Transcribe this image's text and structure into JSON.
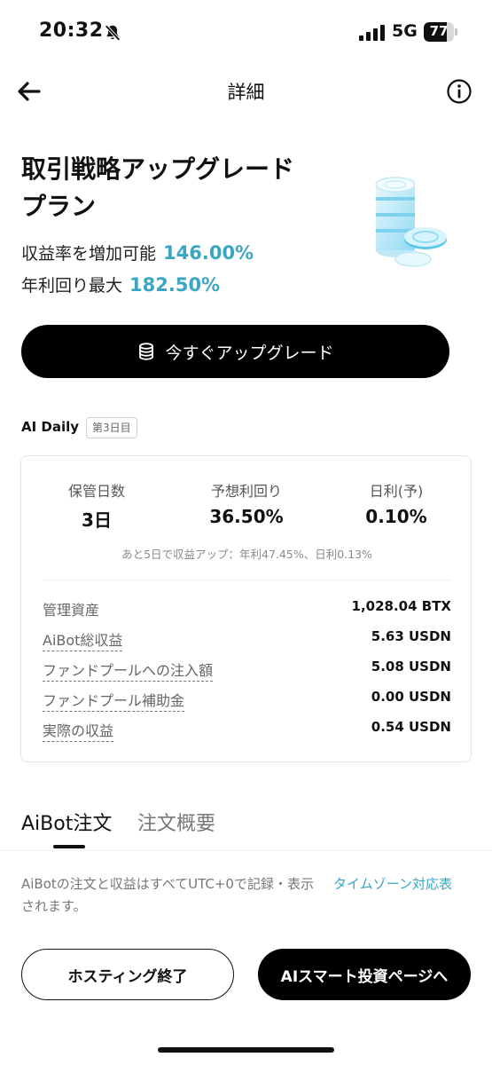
{
  "status_bar": {
    "time": "20:32",
    "network": "5G",
    "battery_percent": "77",
    "battery_level": 0.77
  },
  "nav": {
    "title": "詳細"
  },
  "hero": {
    "title": "取引戦略アップグレードプラン",
    "yield_label": "収益率を増加可能",
    "yield_value": "146.00%",
    "annual_label": "年利回り最大",
    "annual_value": "182.50%",
    "upgrade_button": "今すぐアップグレード"
  },
  "ai_daily": {
    "title": "AI Daily",
    "badge": "第3日目",
    "stats": [
      {
        "label": "保管日数",
        "value": "3日"
      },
      {
        "label": "予想利回り",
        "value": "36.50%"
      },
      {
        "label": "日利(予)",
        "value": "0.10%"
      }
    ],
    "note": "あと5日で収益アップ：年利47.45%、日利0.13%",
    "rows": [
      {
        "label": "管理資産",
        "value": "1,028.04 BTX"
      },
      {
        "label": "AiBot総収益",
        "value": "5.63 USDN"
      },
      {
        "label": "ファンドプールへの注入額",
        "value": "5.08 USDN"
      },
      {
        "label": "ファンドプール補助金",
        "value": "0.00 USDN"
      },
      {
        "label": "実際の収益",
        "value": "0.54 USDN"
      }
    ]
  },
  "tabs": {
    "active": "AiBot注文",
    "inactive": "注文概要"
  },
  "orders": {
    "note": "AiBotの注文と収益はすべてUTC+0で記録・表示されます。",
    "timezone_link": "タイムゾーン対応表"
  },
  "actions": {
    "end_hosting": "ホスティング終了",
    "ai_page": "AIスマート投資ページへ"
  },
  "colors": {
    "accent": "#3aa6c4",
    "primary_button": "#000000"
  },
  "icons": [
    "bell-off-icon",
    "signal-icon",
    "battery-icon",
    "back-arrow-icon",
    "info-icon",
    "coins-illustration",
    "coin-stack-icon"
  ]
}
